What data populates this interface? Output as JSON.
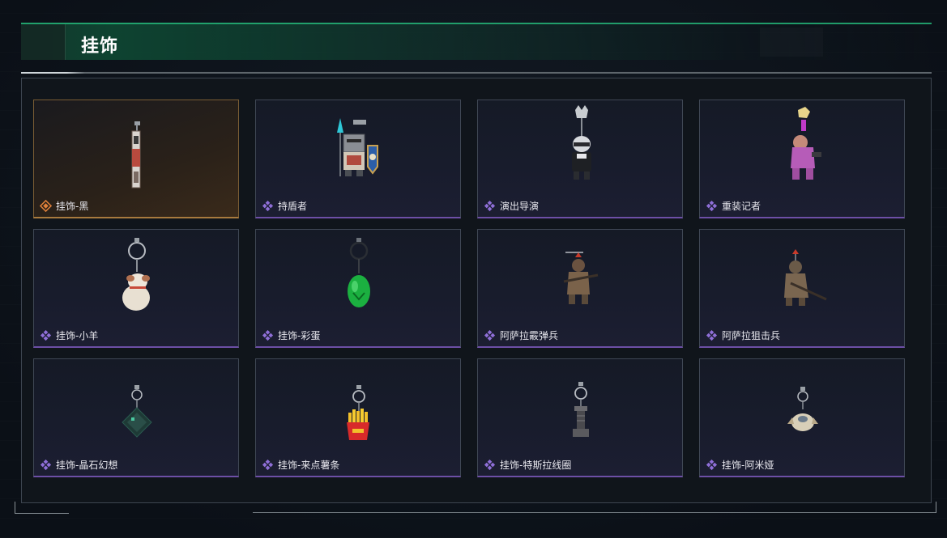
{
  "header": {
    "title": "挂饰"
  },
  "colors": {
    "accent_green": "#24b478",
    "rarity_purple": "#8f6fd8",
    "rarity_gold": "#e0803a"
  },
  "items": [
    {
      "label": "挂饰-黑",
      "rarity": "gold",
      "icon": "rarity-gold-icon"
    },
    {
      "label": "持盾者",
      "rarity": "purple",
      "icon": "rarity-purple-icon"
    },
    {
      "label": "演出导演",
      "rarity": "purple",
      "icon": "rarity-purple-icon"
    },
    {
      "label": "重装记者",
      "rarity": "purple",
      "icon": "rarity-purple-icon"
    },
    {
      "label": "挂饰-小羊",
      "rarity": "purple",
      "icon": "rarity-purple-icon"
    },
    {
      "label": "挂饰-彩蛋",
      "rarity": "purple",
      "icon": "rarity-purple-icon"
    },
    {
      "label": "阿萨拉霰弹兵",
      "rarity": "purple",
      "icon": "rarity-purple-icon"
    },
    {
      "label": "阿萨拉狙击兵",
      "rarity": "purple",
      "icon": "rarity-purple-icon"
    },
    {
      "label": "挂饰-晶石幻想",
      "rarity": "purple",
      "icon": "rarity-purple-icon"
    },
    {
      "label": "挂饰-来点薯条",
      "rarity": "purple",
      "icon": "rarity-purple-icon"
    },
    {
      "label": "挂饰-特斯拉线圈",
      "rarity": "purple",
      "icon": "rarity-purple-icon"
    },
    {
      "label": "挂饰-阿米娅",
      "rarity": "purple",
      "icon": "rarity-purple-icon"
    }
  ]
}
